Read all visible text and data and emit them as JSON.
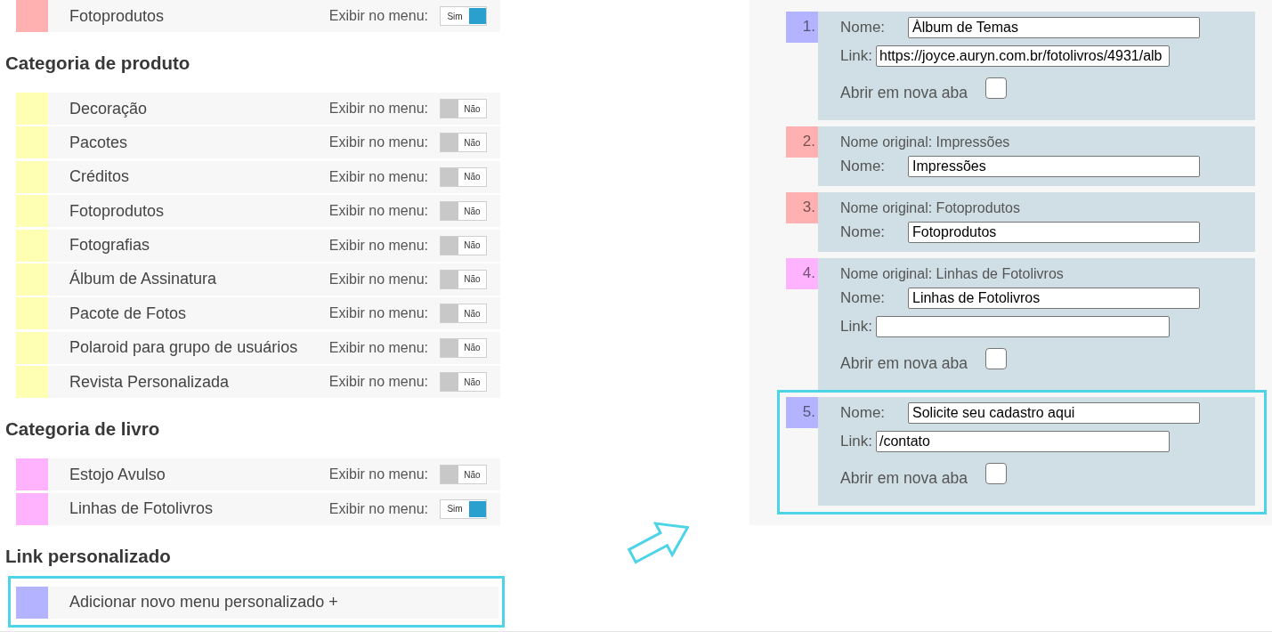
{
  "left_panel": {
    "sections": [
      {
        "rows": [
          {
            "kind": "toggle",
            "label": "Fotoprodutos",
            "color": "#ffb0b0",
            "show_label": "Exibir no menu:",
            "toggle": {
              "on": true,
              "text": "Sim"
            },
            "highlighted": false
          }
        ]
      },
      {
        "heading": "Categoria de produto",
        "rows": [
          {
            "kind": "toggle",
            "label": "Decoração",
            "color": "#ffffb3",
            "show_label": "Exibir no menu:",
            "toggle": {
              "on": false,
              "text": "Não"
            },
            "highlighted": false
          },
          {
            "kind": "toggle",
            "label": "Pacotes",
            "color": "#ffffb3",
            "show_label": "Exibir no menu:",
            "toggle": {
              "on": false,
              "text": "Não"
            },
            "highlighted": false
          },
          {
            "kind": "toggle",
            "label": "Créditos",
            "color": "#ffffb3",
            "show_label": "Exibir no menu:",
            "toggle": {
              "on": false,
              "text": "Não"
            },
            "highlighted": false
          },
          {
            "kind": "toggle",
            "label": "Fotoprodutos",
            "color": "#ffffb3",
            "show_label": "Exibir no menu:",
            "toggle": {
              "on": false,
              "text": "Não"
            },
            "highlighted": false
          },
          {
            "kind": "toggle",
            "label": "Fotografias",
            "color": "#ffffb3",
            "show_label": "Exibir no menu:",
            "toggle": {
              "on": false,
              "text": "Não"
            },
            "highlighted": false
          },
          {
            "kind": "toggle",
            "label": "Álbum de Assinatura",
            "color": "#ffffb3",
            "show_label": "Exibir no menu:",
            "toggle": {
              "on": false,
              "text": "Não"
            },
            "highlighted": false
          },
          {
            "kind": "toggle",
            "label": "Pacote de Fotos",
            "color": "#ffffb3",
            "show_label": "Exibir no menu:",
            "toggle": {
              "on": false,
              "text": "Não"
            },
            "highlighted": false
          },
          {
            "kind": "toggle",
            "label": "Polaroid para grupo de usuários",
            "color": "#ffffb3",
            "show_label": "Exibir no menu:",
            "toggle": {
              "on": false,
              "text": "Não"
            },
            "highlighted": false
          },
          {
            "kind": "toggle",
            "label": "Revista Personalizada",
            "color": "#ffffb3",
            "show_label": "Exibir no menu:",
            "toggle": {
              "on": false,
              "text": "Não"
            },
            "highlighted": false
          }
        ]
      },
      {
        "heading": "Categoria de livro",
        "rows": [
          {
            "kind": "toggle",
            "label": "Estojo Avulso",
            "color": "#ffb3ff",
            "show_label": "Exibir no menu:",
            "toggle": {
              "on": false,
              "text": "Não"
            },
            "highlighted": false
          },
          {
            "kind": "toggle",
            "label": "Linhas de Fotolivros",
            "color": "#ffb3ff",
            "show_label": "Exibir no menu:",
            "toggle": {
              "on": true,
              "text": "Sim"
            },
            "highlighted": false
          }
        ]
      },
      {
        "heading": "Link personalizado",
        "rows": [
          {
            "kind": "add",
            "label": "Adicionar novo menu personalizado +",
            "color": "#b3b3ff",
            "highlighted": true
          }
        ]
      }
    ]
  },
  "right_panel": {
    "items": [
      {
        "number": "1.",
        "color": "#b3b3ff",
        "highlighted": false,
        "fields": [
          {
            "kind": "name",
            "label": "Nome:",
            "value": "Àlbum de Temas"
          },
          {
            "kind": "link",
            "label": "Link:",
            "value": "https://joyce.auryn.com.br/fotolivros/4931/alb"
          }
        ],
        "new_tab": {
          "label": "Abrir em nova aba",
          "checked": false
        }
      },
      {
        "number": "2.",
        "color": "#ffb0b0",
        "highlighted": false,
        "original_name": "Nome original: Impressões",
        "fields": [
          {
            "kind": "name",
            "label": "Nome:",
            "value": "Impressões"
          }
        ]
      },
      {
        "number": "3.",
        "color": "#ffb0b0",
        "highlighted": false,
        "original_name": "Nome original: Fotoprodutos",
        "fields": [
          {
            "kind": "name",
            "label": "Nome:",
            "value": "Fotoprodutos"
          }
        ]
      },
      {
        "number": "4.",
        "color": "#ffb3ff",
        "highlighted": false,
        "original_name": "Nome original: Linhas de Fotolivros",
        "fields": [
          {
            "kind": "name",
            "label": "Nome:",
            "value": "Linhas de Fotolivros"
          },
          {
            "kind": "link",
            "label": "Link:"
          }
        ],
        "new_tab": {
          "label": "Abrir em nova aba",
          "checked": false
        }
      },
      {
        "number": "5.",
        "color": "#b3b3ff",
        "highlighted": true,
        "fields": [
          {
            "kind": "name",
            "label": "Nome:",
            "value": "Solicite seu cadastro aqui"
          },
          {
            "kind": "link",
            "label": "Link:",
            "value": "/contato"
          }
        ],
        "new_tab": {
          "label": "Abrir em nova aba",
          "checked": false
        }
      }
    ]
  }
}
